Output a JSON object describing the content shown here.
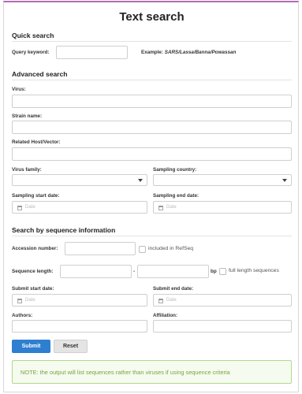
{
  "title": "Text search",
  "quick": {
    "heading": "Quick search",
    "keyword_label": "Query keyword:",
    "keyword_value": "",
    "example_prefix": "Example: ",
    "example_value": "SARS/Lassa/Banna/Powassan"
  },
  "advanced": {
    "heading": "Advanced search",
    "virus_label": "Virus:",
    "strain_label": "Strain name:",
    "host_label": "Related Host/Vector:",
    "family_label": "Virus family:",
    "country_label": "Sampling country:",
    "start_label": "Sampling start date:",
    "end_label": "Sampling end date:",
    "date_placeholder": "Date"
  },
  "sequence": {
    "heading": "Search by sequence information",
    "accession_label": "Accession number:",
    "refseq_label": "included in RefSeq",
    "length_label": "Sequence length:",
    "dash": "-",
    "bp": "bp",
    "full_length_label": "full length sequences",
    "submit_start_label": "Submit start date:",
    "submit_end_label": "Submit end date:",
    "authors_label": "Authors:",
    "affiliation_label": "Affiliation:"
  },
  "buttons": {
    "submit": "Submit",
    "reset": "Reset"
  },
  "note": "NOTE: the output will list sequences rather than viruses if using sequence criteria",
  "colors": {
    "accent_top": "#b06ab3",
    "submit": "#2f7fd0",
    "note_text": "#7aa33f",
    "note_border": "#b5d88a"
  }
}
